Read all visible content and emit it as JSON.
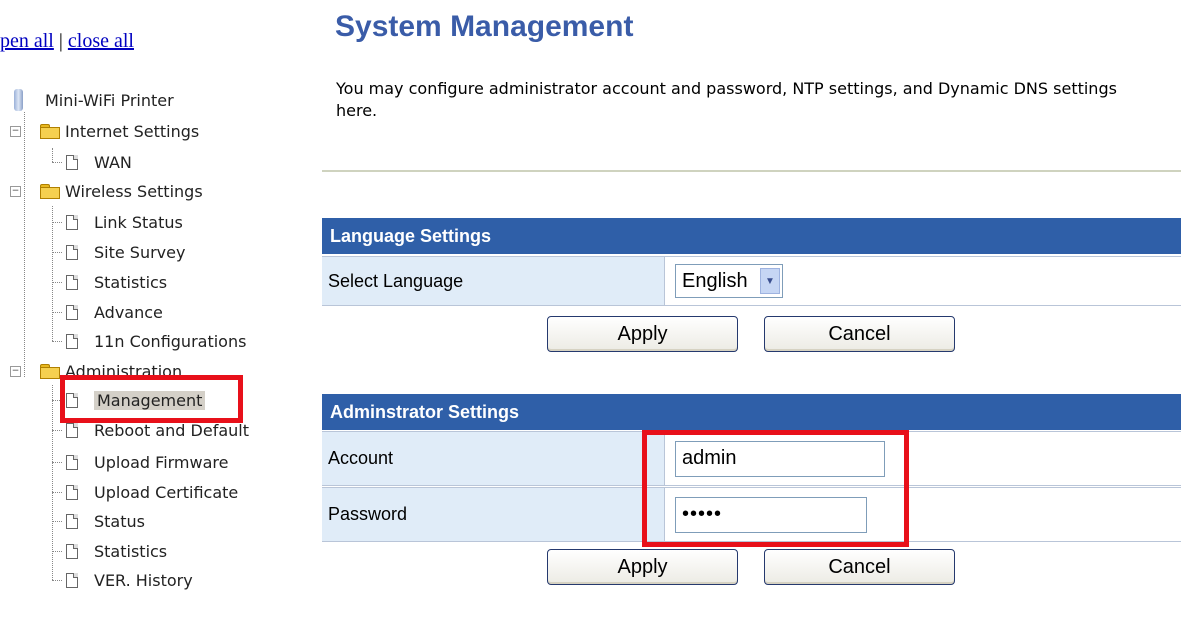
{
  "sidebar": {
    "open_all": "pen all",
    "separator": "|",
    "close_all": "close all",
    "root": "Mini-WiFi Printer",
    "folders": {
      "internet": "Internet Settings",
      "wireless": "Wireless Settings",
      "admin": "Administration"
    },
    "items": {
      "wan": "WAN",
      "link_status": "Link Status",
      "site_survey": "Site Survey",
      "wireless_statistics": "Statistics",
      "advance": "Advance",
      "config_11n": "11n Configurations",
      "management": "Management",
      "reboot": "Reboot and Default",
      "upload_firmware": "Upload Firmware",
      "upload_certificate": "Upload Certificate",
      "status": "Status",
      "admin_statistics": "Statistics",
      "ver_history": "VER. History"
    }
  },
  "main": {
    "title": "System Management",
    "description": "You may configure administrator account and password, NTP settings, and Dynamic DNS settings here.",
    "language": {
      "header": "Language Settings",
      "label": "Select Language",
      "selected": "English",
      "apply": "Apply",
      "cancel": "Cancel"
    },
    "admin": {
      "header": "Adminstrator Settings",
      "account_label": "Account",
      "account_value": "admin",
      "password_label": "Password",
      "password_value": "•••••",
      "apply": "Apply",
      "cancel": "Cancel"
    }
  },
  "colors": {
    "section_header": "#2f5fa8",
    "label_cell": "#e0ecf8",
    "highlight": "#e8101a",
    "title": "#3a5ca8"
  }
}
